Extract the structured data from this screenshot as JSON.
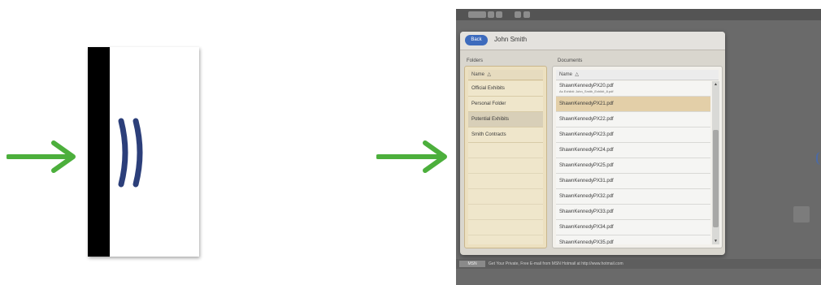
{
  "topbar": {
    "zoom_label": "100%"
  },
  "window": {
    "back_label": "Back",
    "title": "John Smith",
    "folders_label": "Folders",
    "documents_label": "Documents",
    "name_column": "Name",
    "sort_icon": "triangle-sort-icon"
  },
  "folders": [
    "Official Exhibits",
    "Personal Folder",
    "Potential Exhibits",
    "Smith Contracts"
  ],
  "selected_folder": "Potential Exhibits",
  "documents": {
    "first": {
      "name": "ShawnKennedyPX20.pdf",
      "sub": "As Exhibit: John_Smith_Exhibit_8.pdf"
    },
    "rows": [
      "ShawnKennedyPX21.pdf",
      "ShawnKennedyPX22.pdf",
      "ShawnKennedyPX23.pdf",
      "ShawnKennedyPX24.pdf",
      "ShawnKennedyPX25.pdf",
      "ShawnKennedyPX31.pdf",
      "ShawnKennedyPX32.pdf",
      "ShawnKennedyPX33.pdf",
      "ShawnKennedyPX34.pdf",
      "ShawnKennedyPX35.pdf"
    ],
    "selected": "ShawnKennedyPX21.pdf"
  },
  "status": {
    "tag": "MSN",
    "text": "Get Your Private, Free E-mail from MSN Hotmail at http://www.hotmail.com"
  },
  "colors": {
    "arrow": "#4caf3c",
    "chevron": "#2c3f7a",
    "back_button": "#3d6bbd",
    "selection": "#e3cfa8"
  }
}
